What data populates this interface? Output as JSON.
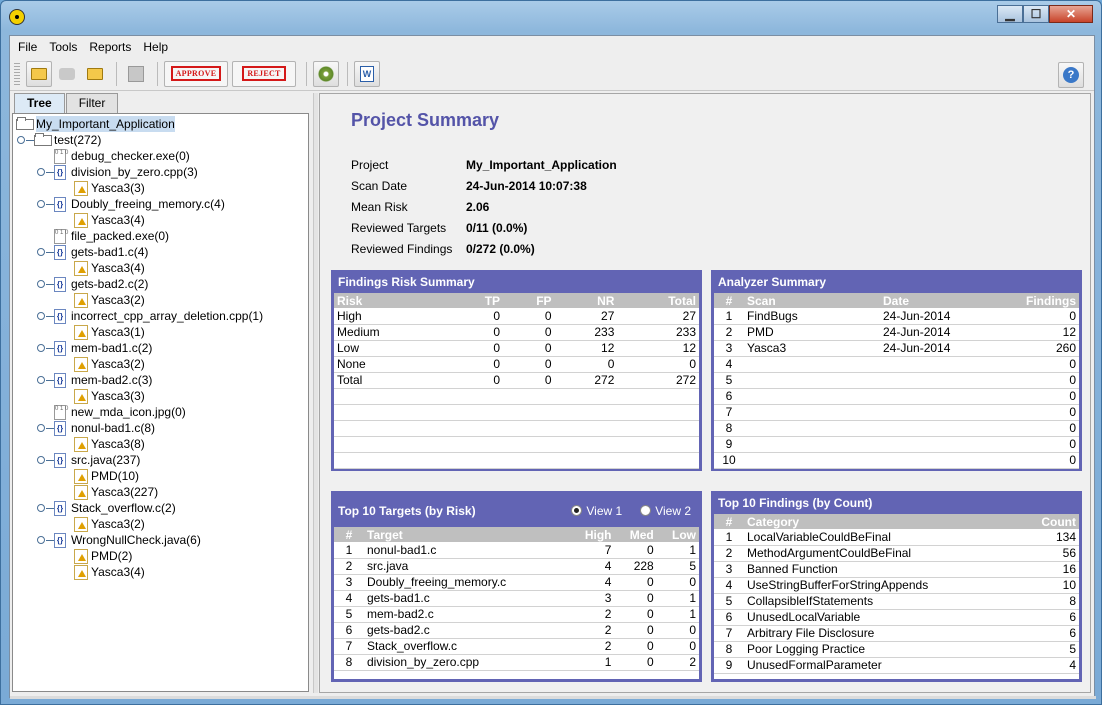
{
  "menu": [
    "File",
    "Tools",
    "Reports",
    "Help"
  ],
  "toolbar": {
    "approve_label": "APPROVE",
    "reject_label": "REJECT",
    "icons": [
      "new-project-icon",
      "comment-icon",
      "open-folder-icon",
      "save-icon",
      "approve-stamp-icon",
      "reject-stamp-icon",
      "settings-gear-icon",
      "word-report-icon",
      "help-icon"
    ]
  },
  "window": {
    "min_label": "▁",
    "max_label": "☐",
    "close_label": "✕"
  },
  "left_tabs": [
    "Tree",
    "Filter"
  ],
  "tree": [
    {
      "label": "My_Important_Application",
      "icon": "folder",
      "depth": 0,
      "toggle": false,
      "selected": true
    },
    {
      "label": "test(272)",
      "icon": "folder",
      "depth": 1,
      "toggle": true
    },
    {
      "label": "debug_checker.exe(0)",
      "icon": "binary",
      "depth": 2,
      "toggle": false
    },
    {
      "label": "division_by_zero.cpp(3)",
      "icon": "source",
      "depth": 2,
      "toggle": true
    },
    {
      "label": "Yasca3(3)",
      "icon": "warning",
      "depth": 3,
      "toggle": false
    },
    {
      "label": "Doubly_freeing_memory.c(4)",
      "icon": "source",
      "depth": 2,
      "toggle": true
    },
    {
      "label": "Yasca3(4)",
      "icon": "warning",
      "depth": 3,
      "toggle": false
    },
    {
      "label": "file_packed.exe(0)",
      "icon": "binary",
      "depth": 2,
      "toggle": false
    },
    {
      "label": "gets-bad1.c(4)",
      "icon": "source",
      "depth": 2,
      "toggle": true
    },
    {
      "label": "Yasca3(4)",
      "icon": "warning",
      "depth": 3,
      "toggle": false
    },
    {
      "label": "gets-bad2.c(2)",
      "icon": "source",
      "depth": 2,
      "toggle": true
    },
    {
      "label": "Yasca3(2)",
      "icon": "warning",
      "depth": 3,
      "toggle": false
    },
    {
      "label": "incorrect_cpp_array_deletion.cpp(1)",
      "icon": "source",
      "depth": 2,
      "toggle": true
    },
    {
      "label": "Yasca3(1)",
      "icon": "warning",
      "depth": 3,
      "toggle": false
    },
    {
      "label": "mem-bad1.c(2)",
      "icon": "source",
      "depth": 2,
      "toggle": true
    },
    {
      "label": "Yasca3(2)",
      "icon": "warning",
      "depth": 3,
      "toggle": false
    },
    {
      "label": "mem-bad2.c(3)",
      "icon": "source",
      "depth": 2,
      "toggle": true
    },
    {
      "label": "Yasca3(3)",
      "icon": "warning",
      "depth": 3,
      "toggle": false
    },
    {
      "label": "new_mda_icon.jpg(0)",
      "icon": "binary",
      "depth": 2,
      "toggle": false
    },
    {
      "label": "nonul-bad1.c(8)",
      "icon": "source",
      "depth": 2,
      "toggle": true
    },
    {
      "label": "Yasca3(8)",
      "icon": "warning",
      "depth": 3,
      "toggle": false
    },
    {
      "label": "src.java(237)",
      "icon": "source",
      "depth": 2,
      "toggle": true
    },
    {
      "label": "PMD(10)",
      "icon": "warning",
      "depth": 3,
      "toggle": false
    },
    {
      "label": "Yasca3(227)",
      "icon": "warning",
      "depth": 3,
      "toggle": false
    },
    {
      "label": "Stack_overflow.c(2)",
      "icon": "source",
      "depth": 2,
      "toggle": true
    },
    {
      "label": "Yasca3(2)",
      "icon": "warning",
      "depth": 3,
      "toggle": false
    },
    {
      "label": "WrongNullCheck.java(6)",
      "icon": "source",
      "depth": 2,
      "toggle": true
    },
    {
      "label": "PMD(2)",
      "icon": "warning",
      "depth": 3,
      "toggle": false
    },
    {
      "label": "Yasca3(4)",
      "icon": "warning",
      "depth": 3,
      "toggle": false
    }
  ],
  "summary": {
    "title": "Project Summary",
    "fields": [
      {
        "label": "Project",
        "value": "My_Important_Application"
      },
      {
        "label": "Scan Date",
        "value": "24-Jun-2014 10:07:38"
      },
      {
        "label": "Mean Risk",
        "value": "2.06"
      },
      {
        "label": "Reviewed Targets",
        "value": "0/11 (0.0%)"
      },
      {
        "label": "Reviewed Findings",
        "value": "0/272 (0.0%)"
      }
    ]
  },
  "findings_risk": {
    "title": "Findings Risk Summary",
    "headers": [
      "Risk",
      "TP",
      "FP",
      "NR",
      "Total"
    ],
    "rows": [
      [
        "High",
        "0",
        "0",
        "27",
        "27"
      ],
      [
        "Medium",
        "0",
        "0",
        "233",
        "233"
      ],
      [
        "Low",
        "0",
        "0",
        "12",
        "12"
      ],
      [
        "None",
        "0",
        "0",
        "0",
        "0"
      ],
      [
        "Total",
        "0",
        "0",
        "272",
        "272"
      ]
    ]
  },
  "analyzer": {
    "title": "Analyzer Summary",
    "headers": [
      "#",
      "Scan",
      "Date",
      "Findings"
    ],
    "rows": [
      [
        "1",
        "FindBugs",
        "24-Jun-2014",
        "0"
      ],
      [
        "2",
        "PMD",
        "24-Jun-2014",
        "12"
      ],
      [
        "3",
        "Yasca3",
        "24-Jun-2014",
        "260"
      ],
      [
        "4",
        "",
        "",
        "0"
      ],
      [
        "5",
        "",
        "",
        "0"
      ],
      [
        "6",
        "",
        "",
        "0"
      ],
      [
        "7",
        "",
        "",
        "0"
      ],
      [
        "8",
        "",
        "",
        "0"
      ],
      [
        "9",
        "",
        "",
        "0"
      ],
      [
        "10",
        "",
        "",
        "0"
      ]
    ]
  },
  "top_targets": {
    "title": "Top 10 Targets (by Risk)",
    "view1": "View 1",
    "view2": "View 2",
    "selected_view": "View 1",
    "headers": [
      "#",
      "Target",
      "High",
      "Med",
      "Low"
    ],
    "rows": [
      [
        "1",
        "nonul-bad1.c",
        "7",
        "0",
        "1"
      ],
      [
        "2",
        "src.java",
        "4",
        "228",
        "5"
      ],
      [
        "3",
        "Doubly_freeing_memory.c",
        "4",
        "0",
        "0"
      ],
      [
        "4",
        "gets-bad1.c",
        "3",
        "0",
        "1"
      ],
      [
        "5",
        "mem-bad2.c",
        "2",
        "0",
        "1"
      ],
      [
        "6",
        "gets-bad2.c",
        "2",
        "0",
        "0"
      ],
      [
        "7",
        "Stack_overflow.c",
        "2",
        "0",
        "0"
      ],
      [
        "8",
        "division_by_zero.cpp",
        "1",
        "0",
        "2"
      ]
    ]
  },
  "top_findings": {
    "title": "Top 10 Findings (by Count)",
    "headers": [
      "#",
      "Category",
      "Count"
    ],
    "rows": [
      [
        "1",
        "LocalVariableCouldBeFinal",
        "134"
      ],
      [
        "2",
        "MethodArgumentCouldBeFinal",
        "56"
      ],
      [
        "3",
        "Banned Function",
        "16"
      ],
      [
        "4",
        "UseStringBufferForStringAppends",
        "10"
      ],
      [
        "5",
        "CollapsibleIfStatements",
        "8"
      ],
      [
        "6",
        "UnusedLocalVariable",
        "6"
      ],
      [
        "7",
        "Arbitrary File Disclosure",
        "6"
      ],
      [
        "8",
        "Poor Logging Practice",
        "5"
      ],
      [
        "9",
        "UnusedFormalParameter",
        "4"
      ]
    ]
  },
  "colors": {
    "panel_header": "#6264b4",
    "title": "#5454a8",
    "column_header": "#bfbfbf",
    "stamp": "#d41818"
  }
}
